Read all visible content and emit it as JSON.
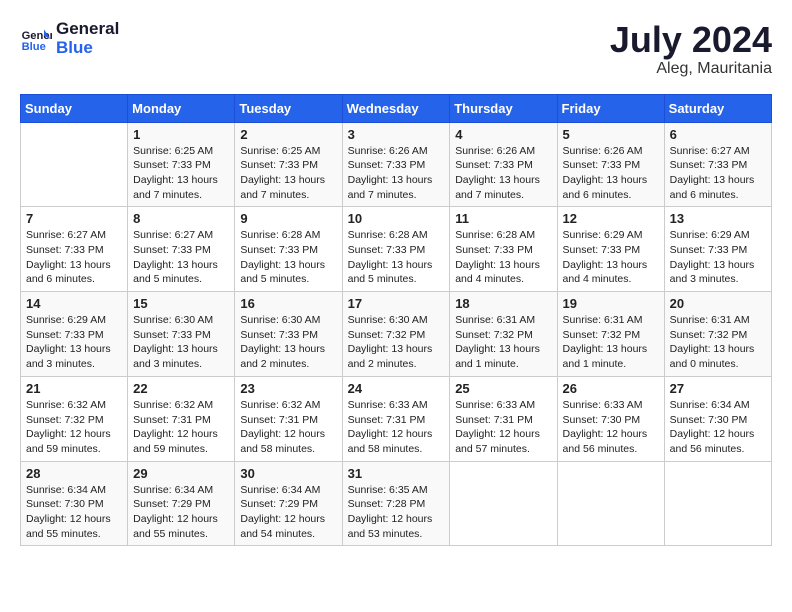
{
  "header": {
    "logo_line1": "General",
    "logo_line2": "Blue",
    "month": "July 2024",
    "location": "Aleg, Mauritania"
  },
  "weekdays": [
    "Sunday",
    "Monday",
    "Tuesday",
    "Wednesday",
    "Thursday",
    "Friday",
    "Saturday"
  ],
  "weeks": [
    [
      {
        "day": "",
        "info": ""
      },
      {
        "day": "1",
        "info": "Sunrise: 6:25 AM\nSunset: 7:33 PM\nDaylight: 13 hours\nand 7 minutes."
      },
      {
        "day": "2",
        "info": "Sunrise: 6:25 AM\nSunset: 7:33 PM\nDaylight: 13 hours\nand 7 minutes."
      },
      {
        "day": "3",
        "info": "Sunrise: 6:26 AM\nSunset: 7:33 PM\nDaylight: 13 hours\nand 7 minutes."
      },
      {
        "day": "4",
        "info": "Sunrise: 6:26 AM\nSunset: 7:33 PM\nDaylight: 13 hours\nand 7 minutes."
      },
      {
        "day": "5",
        "info": "Sunrise: 6:26 AM\nSunset: 7:33 PM\nDaylight: 13 hours\nand 6 minutes."
      },
      {
        "day": "6",
        "info": "Sunrise: 6:27 AM\nSunset: 7:33 PM\nDaylight: 13 hours\nand 6 minutes."
      }
    ],
    [
      {
        "day": "7",
        "info": "Sunrise: 6:27 AM\nSunset: 7:33 PM\nDaylight: 13 hours\nand 6 minutes."
      },
      {
        "day": "8",
        "info": "Sunrise: 6:27 AM\nSunset: 7:33 PM\nDaylight: 13 hours\nand 5 minutes."
      },
      {
        "day": "9",
        "info": "Sunrise: 6:28 AM\nSunset: 7:33 PM\nDaylight: 13 hours\nand 5 minutes."
      },
      {
        "day": "10",
        "info": "Sunrise: 6:28 AM\nSunset: 7:33 PM\nDaylight: 13 hours\nand 5 minutes."
      },
      {
        "day": "11",
        "info": "Sunrise: 6:28 AM\nSunset: 7:33 PM\nDaylight: 13 hours\nand 4 minutes."
      },
      {
        "day": "12",
        "info": "Sunrise: 6:29 AM\nSunset: 7:33 PM\nDaylight: 13 hours\nand 4 minutes."
      },
      {
        "day": "13",
        "info": "Sunrise: 6:29 AM\nSunset: 7:33 PM\nDaylight: 13 hours\nand 3 minutes."
      }
    ],
    [
      {
        "day": "14",
        "info": "Sunrise: 6:29 AM\nSunset: 7:33 PM\nDaylight: 13 hours\nand 3 minutes."
      },
      {
        "day": "15",
        "info": "Sunrise: 6:30 AM\nSunset: 7:33 PM\nDaylight: 13 hours\nand 3 minutes."
      },
      {
        "day": "16",
        "info": "Sunrise: 6:30 AM\nSunset: 7:33 PM\nDaylight: 13 hours\nand 2 minutes."
      },
      {
        "day": "17",
        "info": "Sunrise: 6:30 AM\nSunset: 7:32 PM\nDaylight: 13 hours\nand 2 minutes."
      },
      {
        "day": "18",
        "info": "Sunrise: 6:31 AM\nSunset: 7:32 PM\nDaylight: 13 hours\nand 1 minute."
      },
      {
        "day": "19",
        "info": "Sunrise: 6:31 AM\nSunset: 7:32 PM\nDaylight: 13 hours\nand 1 minute."
      },
      {
        "day": "20",
        "info": "Sunrise: 6:31 AM\nSunset: 7:32 PM\nDaylight: 13 hours\nand 0 minutes."
      }
    ],
    [
      {
        "day": "21",
        "info": "Sunrise: 6:32 AM\nSunset: 7:32 PM\nDaylight: 12 hours\nand 59 minutes."
      },
      {
        "day": "22",
        "info": "Sunrise: 6:32 AM\nSunset: 7:31 PM\nDaylight: 12 hours\nand 59 minutes."
      },
      {
        "day": "23",
        "info": "Sunrise: 6:32 AM\nSunset: 7:31 PM\nDaylight: 12 hours\nand 58 minutes."
      },
      {
        "day": "24",
        "info": "Sunrise: 6:33 AM\nSunset: 7:31 PM\nDaylight: 12 hours\nand 58 minutes."
      },
      {
        "day": "25",
        "info": "Sunrise: 6:33 AM\nSunset: 7:31 PM\nDaylight: 12 hours\nand 57 minutes."
      },
      {
        "day": "26",
        "info": "Sunrise: 6:33 AM\nSunset: 7:30 PM\nDaylight: 12 hours\nand 56 minutes."
      },
      {
        "day": "27",
        "info": "Sunrise: 6:34 AM\nSunset: 7:30 PM\nDaylight: 12 hours\nand 56 minutes."
      }
    ],
    [
      {
        "day": "28",
        "info": "Sunrise: 6:34 AM\nSunset: 7:30 PM\nDaylight: 12 hours\nand 55 minutes."
      },
      {
        "day": "29",
        "info": "Sunrise: 6:34 AM\nSunset: 7:29 PM\nDaylight: 12 hours\nand 55 minutes."
      },
      {
        "day": "30",
        "info": "Sunrise: 6:34 AM\nSunset: 7:29 PM\nDaylight: 12 hours\nand 54 minutes."
      },
      {
        "day": "31",
        "info": "Sunrise: 6:35 AM\nSunset: 7:28 PM\nDaylight: 12 hours\nand 53 minutes."
      },
      {
        "day": "",
        "info": ""
      },
      {
        "day": "",
        "info": ""
      },
      {
        "day": "",
        "info": ""
      }
    ]
  ]
}
